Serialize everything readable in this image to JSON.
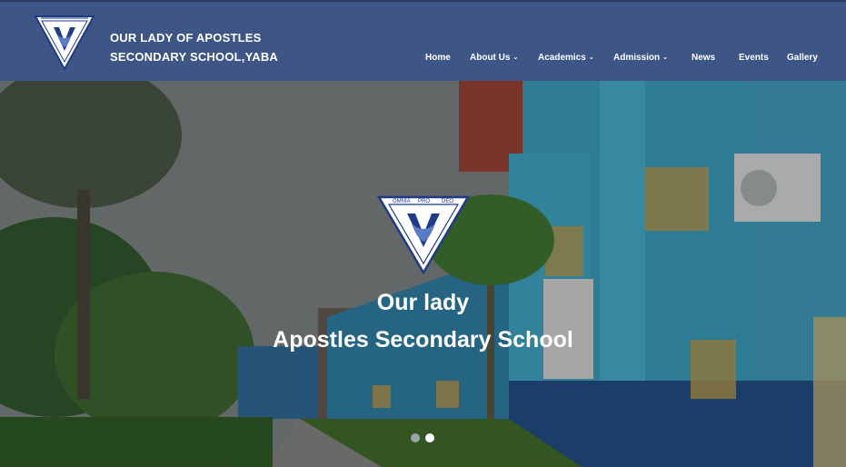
{
  "header": {
    "school_name_line1": "OUR LADY OF APOSTLES",
    "school_name_line2": "SECONDARY SCHOOL,YABA",
    "logo_motto_left": "OMNIA",
    "logo_motto_mid": "PRO",
    "logo_motto_right": "DEO"
  },
  "nav": {
    "items": [
      {
        "label": "Home",
        "dropdown": false
      },
      {
        "label": "About Us",
        "dropdown": true
      },
      {
        "label": "Academics",
        "dropdown": true
      },
      {
        "label": "Admission",
        "dropdown": true
      },
      {
        "label": "News",
        "dropdown": false
      },
      {
        "label": "Events",
        "dropdown": false
      },
      {
        "label": "Gallery",
        "dropdown": false
      }
    ],
    "chevron": "⌄"
  },
  "hero": {
    "title_line1": "Our lady",
    "title_line2": "Apostles Secondary School",
    "slides_total": 2,
    "active_slide": 2
  },
  "colors": {
    "header_bg": "#3d5686",
    "building_blue": "#3aa9c9",
    "dot_inactive": "#9aa2aa",
    "dot_active": "#ffffff"
  }
}
